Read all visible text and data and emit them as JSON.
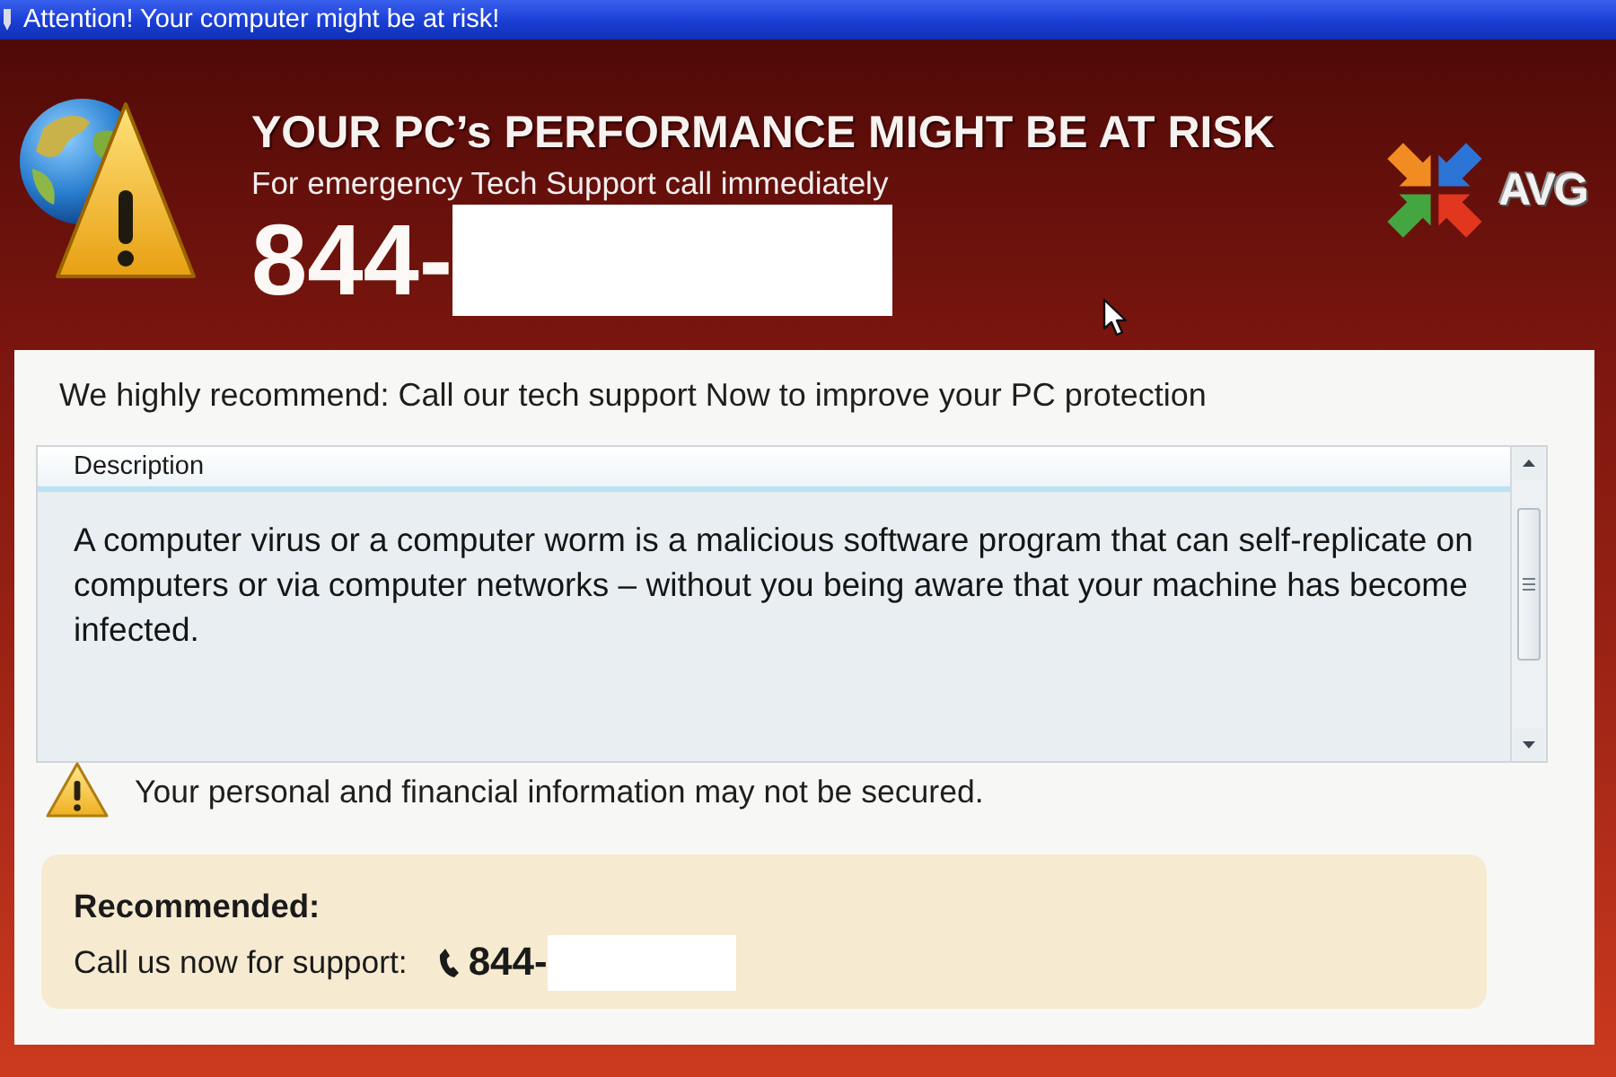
{
  "window": {
    "title": "Attention! Your computer might be at risk!"
  },
  "header": {
    "headline": "YOUR PC’s PERFORMANCE MIGHT BE AT RISK",
    "subtitle": "For emergency Tech Support call immediately",
    "phone": "844-",
    "logo_text": "AVG"
  },
  "panel": {
    "recommendation": "We highly recommend: Call our tech support Now to improve your PC protection",
    "description": {
      "heading": "Description",
      "body": "A computer virus or a computer worm is a malicious software program that can self-replicate on computers or via computer networks – without you being aware that your machine has become infected."
    },
    "warning": "Your personal and financial information may not be secured.",
    "recommended": {
      "title": "Recommended:",
      "label": "Call us now for support:",
      "phone": "844-"
    }
  }
}
